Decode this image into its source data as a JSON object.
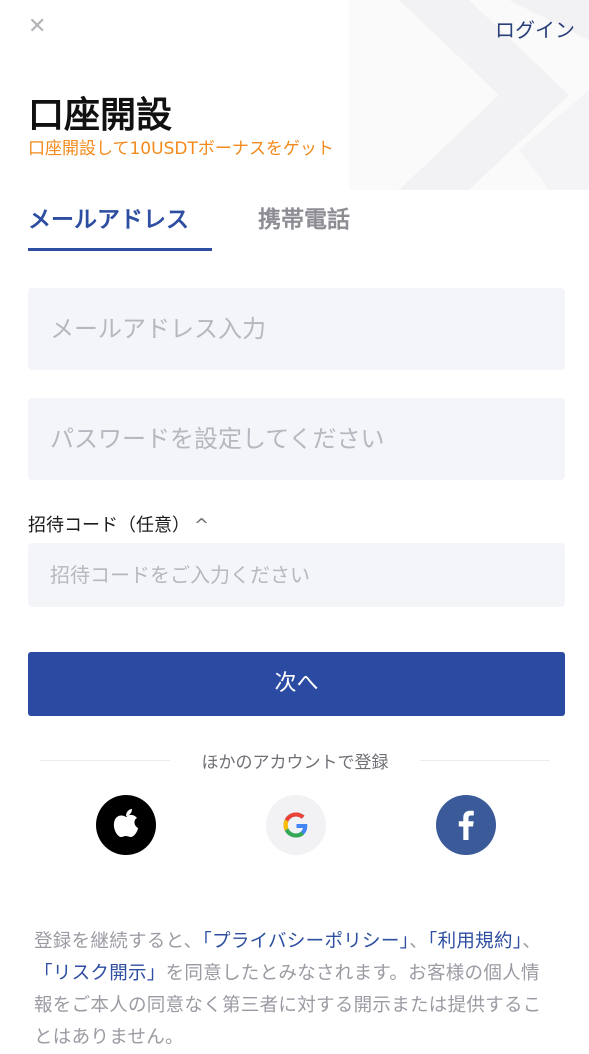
{
  "header": {
    "close_icon": "close-icon",
    "login_label": "ログイン"
  },
  "title": "口座開設",
  "promo": "口座開設して10USDTボーナスをゲット",
  "tabs": [
    {
      "label": "メールアドレス",
      "active": true
    },
    {
      "label": "携帯電話",
      "active": false
    }
  ],
  "form": {
    "email_placeholder": "メールアドレス入力",
    "password_placeholder": "パスワードを設定してください",
    "invite_label": "招待コード（任意）",
    "invite_chevron": "^",
    "invite_placeholder": "招待コードをご入力ください",
    "next_button": "次へ"
  },
  "social": {
    "divider_text": "ほかのアカウントで登録",
    "providers": [
      "apple-icon",
      "google-icon",
      "facebook-icon"
    ]
  },
  "terms": {
    "t1": "登録を継続すると、",
    "privacy": "「プライバシーポリシー」",
    "t2": "、",
    "usage": "「利用規約」",
    "t3": "、",
    "risk": "「リスク開示」",
    "t4": "を同意したとみなされます。お客様の個人情報をご本人の同意なく第三者に対する開示または提供することはありません。"
  },
  "colors": {
    "accent": "#2b4aa2",
    "promo": "#f28a1c",
    "field_bg": "#f4f5f9"
  }
}
